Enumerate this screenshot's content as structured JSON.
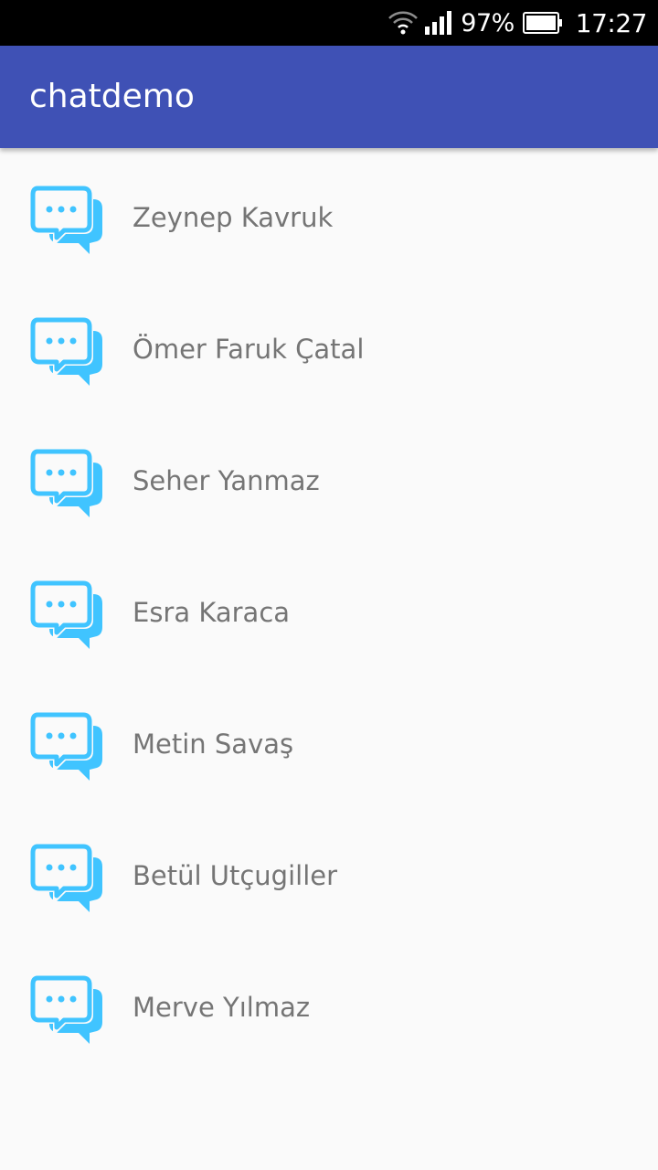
{
  "status_bar": {
    "battery_percent": "97%",
    "time": "17:27",
    "icons": [
      "wifi-icon",
      "signal-icon",
      "battery-icon"
    ]
  },
  "app_bar": {
    "title": "chatdemo",
    "color": "#3f51b5"
  },
  "accent_color": "#40c4ff",
  "contacts": [
    {
      "name": "Zeynep Kavruk",
      "icon": "chat-bubbles-icon"
    },
    {
      "name": "Ömer Faruk Çatal",
      "icon": "chat-bubbles-icon"
    },
    {
      "name": "Seher Yanmaz",
      "icon": "chat-bubbles-icon"
    },
    {
      "name": "Esra Karaca",
      "icon": "chat-bubbles-icon"
    },
    {
      "name": "Metin Savaş",
      "icon": "chat-bubbles-icon"
    },
    {
      "name": "Betül Utçugiller",
      "icon": "chat-bubbles-icon"
    },
    {
      "name": "Merve Yılmaz",
      "icon": "chat-bubbles-icon"
    }
  ]
}
